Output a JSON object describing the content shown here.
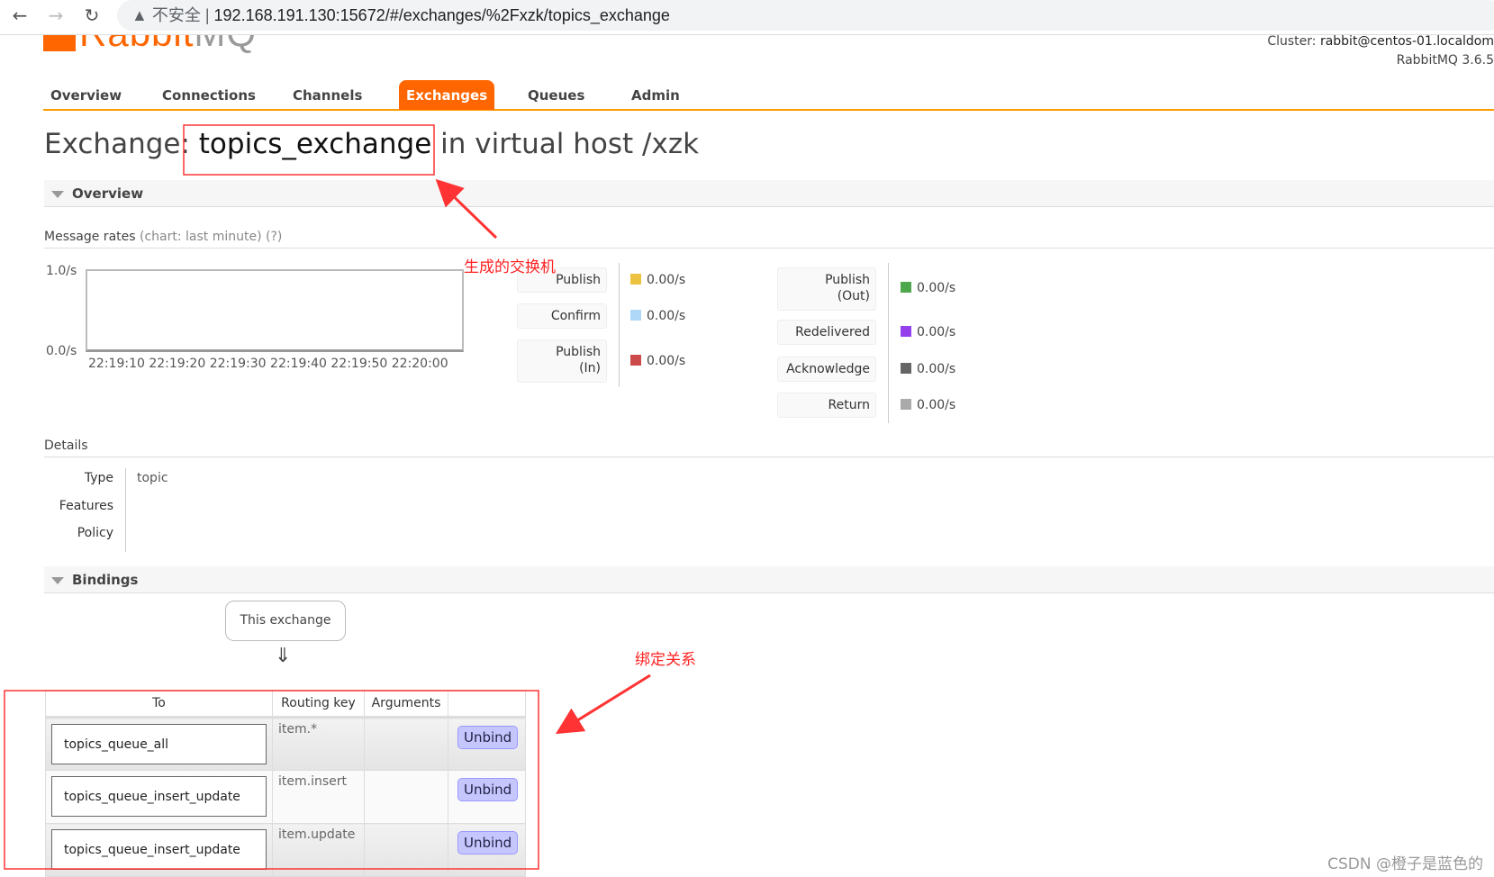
{
  "browser": {
    "security_label": "不安全",
    "url": "192.168.191.130:15672/#/exchanges/%2Fxzk/topics_exchange"
  },
  "header": {
    "logo_main": "Rabbit",
    "logo_suffix": "MQ",
    "cluster_label": "Cluster:",
    "cluster_value": "rabbit@centos-01.localdom",
    "version": "RabbitMQ 3.6.5"
  },
  "tabs": [
    {
      "label": "Overview"
    },
    {
      "label": "Connections"
    },
    {
      "label": "Channels"
    },
    {
      "label": "Exchanges",
      "active": true
    },
    {
      "label": "Queues"
    },
    {
      "label": "Admin"
    }
  ],
  "page": {
    "title_prefix": "Exchange:",
    "exchange_name": "topics_exchange",
    "title_suffix": "in virtual host /xzk"
  },
  "overview": {
    "section_title": "Overview",
    "rates_label": "Message rates",
    "rates_hint": "(chart: last minute) (?)",
    "chart_data": {
      "type": "line",
      "y_ticks": [
        "1.0/s",
        "0.0/s"
      ],
      "x_ticks": [
        "22:19:10",
        "22:19:20",
        "22:19:30",
        "22:19:40",
        "22:19:50",
        "22:20:00"
      ],
      "ylim": [
        0,
        1
      ],
      "series": []
    },
    "legend_left": [
      {
        "label": "Publish",
        "value": "0.00/s",
        "color": "#edc240"
      },
      {
        "label": "Confirm",
        "value": "0.00/s",
        "color": "#afd8f8"
      },
      {
        "label": "Publish (In)",
        "value": "0.00/s",
        "color": "#cb4b4b"
      }
    ],
    "legend_right": [
      {
        "label": "Publish (Out)",
        "value": "0.00/s",
        "color": "#4da74d"
      },
      {
        "label": "Redelivered",
        "value": "0.00/s",
        "color": "#9440ed"
      },
      {
        "label": "Acknowledge",
        "value": "0.00/s",
        "color": "#666666"
      },
      {
        "label": "Return",
        "value": "0.00/s",
        "color": "#aaaaaa"
      }
    ]
  },
  "details": {
    "title": "Details",
    "rows": [
      {
        "key": "Type",
        "value": "topic"
      },
      {
        "key": "Features",
        "value": ""
      },
      {
        "key": "Policy",
        "value": ""
      }
    ]
  },
  "bindings": {
    "section_title": "Bindings",
    "source_label": "This exchange",
    "arrow": "⇓",
    "columns": [
      "To",
      "Routing key",
      "Arguments",
      ""
    ],
    "rows": [
      {
        "to": "topics_queue_all",
        "routing_key": "item.*",
        "arguments": "",
        "action": "Unbind"
      },
      {
        "to": "topics_queue_insert_update",
        "routing_key": "item.insert",
        "arguments": "",
        "action": "Unbind"
      },
      {
        "to": "topics_queue_insert_update",
        "routing_key": "item.update",
        "arguments": "",
        "action": "Unbind"
      }
    ]
  },
  "annotations": {
    "exchange_note": "生成的交换机",
    "binding_note": "绑定关系",
    "accent": "#ff2222"
  },
  "watermark": "CSDN @橙子是蓝色的"
}
